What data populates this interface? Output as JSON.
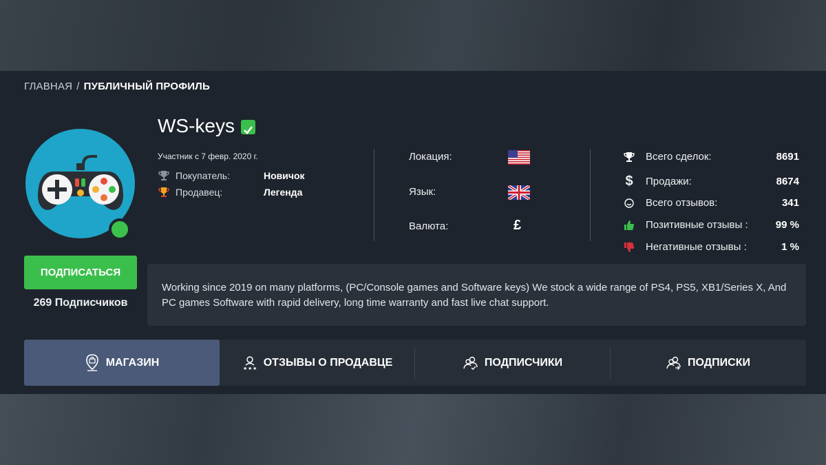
{
  "breadcrumb": {
    "home": "ГЛАВНАЯ",
    "separator": "/",
    "current": "ПУБЛИЧНЫЙ ПРОФИЛЬ"
  },
  "profile": {
    "username": "WS-keys",
    "member_since": "Участник с 7 февр. 2020 г.",
    "buyer_label": "Покупатель:",
    "buyer_value": "Новичок",
    "seller_label": "Продавец:",
    "seller_value": "Легенда",
    "subscribe_label": "ПОДПИСАТЬСЯ",
    "subscribers": "269 Подписчиков",
    "online_color": "#3cc24a"
  },
  "info": {
    "location_label": "Локация:",
    "location_flag": "us-flag-icon",
    "language_label": "Язык:",
    "language_flag": "uk-flag-icon",
    "currency_label": "Валюта:",
    "currency_symbol": "£"
  },
  "stats": {
    "total_deals_label": "Всего сделок:",
    "total_deals": "8691",
    "sales_label": "Продажи:",
    "sales": "8674",
    "total_reviews_label": "Всего отзывов:",
    "total_reviews": "341",
    "positive_label": "Позитивные отзывы :",
    "positive": "99 %",
    "negative_label": "Негативные отзывы :",
    "negative": "1 %"
  },
  "description": "Working since 2019 on many platforms, (PC/Console games and Software keys) We stock a wide range of PS4, PS5, XB1/Series X, And PC games Software with rapid delivery, long time warranty and fast live chat support.",
  "tabs": [
    {
      "label": "МАГАЗИН",
      "icon": "shop-icon",
      "active": true
    },
    {
      "label": "ОТЗЫВЫ О ПРОДАВЦЕ",
      "icon": "reviews-icon",
      "active": false
    },
    {
      "label": "ПОДПИСЧИКИ",
      "icon": "followers-icon",
      "active": false
    },
    {
      "label": "ПОДПИСКИ",
      "icon": "subscriptions-icon",
      "active": false
    }
  ],
  "colors": {
    "accent_green": "#3bbf4c",
    "avatar_bg": "#1fa5c9",
    "active_tab": "#4a5a78",
    "panel_bg": "#1e242d"
  }
}
